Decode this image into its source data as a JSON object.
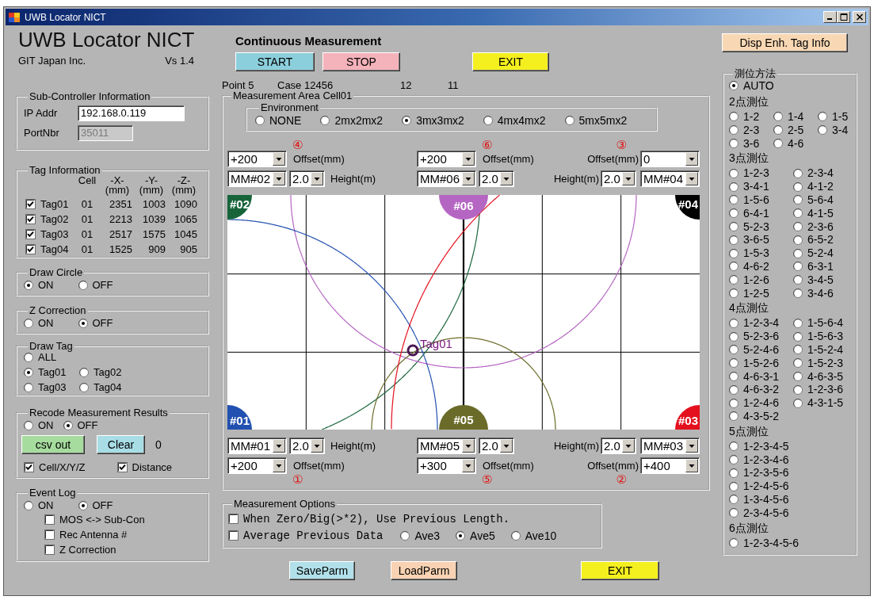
{
  "window": {
    "title": "UWB Locator NICT"
  },
  "header": {
    "title": "UWB Locator NICT",
    "company": "GIT Japan Inc.",
    "version": "Vs 1.4"
  },
  "sub_controller": {
    "title": "Sub-Controller Information",
    "fields": [
      {
        "label": "IP Addr",
        "value": "192.168.0.119",
        "disabled": false
      },
      {
        "label": "PortNbr",
        "value": "35011",
        "disabled": true
      }
    ]
  },
  "tag_information": {
    "title": "Tag Information",
    "columns": [
      {
        "label": "Cell"
      },
      {
        "label": "-X-",
        "unit": "(mm)"
      },
      {
        "label": "-Y-",
        "unit": "(mm)"
      },
      {
        "label": "-Z-",
        "unit": "(mm)"
      }
    ],
    "rows": [
      {
        "checked": true,
        "name": "Tag01",
        "cells": [
          "01",
          "2351",
          "1003",
          "1090"
        ]
      },
      {
        "checked": true,
        "name": "Tag02",
        "cells": [
          "01",
          "2213",
          "1039",
          "1065"
        ]
      },
      {
        "checked": true,
        "name": "Tag03",
        "cells": [
          "01",
          "2517",
          "1575",
          "1045"
        ]
      },
      {
        "checked": true,
        "name": "Tag04",
        "cells": [
          "01",
          "1525",
          "909",
          "905"
        ]
      }
    ]
  },
  "draw_circle": {
    "title": "Draw Circle",
    "options": [
      {
        "label": "ON",
        "selected": true
      },
      {
        "label": "OFF",
        "selected": false
      }
    ]
  },
  "z_correction": {
    "title": "Z Correction",
    "options": [
      {
        "label": "ON",
        "selected": false
      },
      {
        "label": "OFF",
        "selected": true
      }
    ]
  },
  "draw_tag": {
    "title": "Draw Tag",
    "rows": [
      [
        {
          "label": "ALL",
          "selected": false
        }
      ],
      [
        {
          "label": "Tag01",
          "selected": true
        },
        {
          "label": "Tag02",
          "selected": false
        }
      ],
      [
        {
          "label": "Tag03",
          "selected": false
        },
        {
          "label": "Tag04",
          "selected": false
        }
      ]
    ]
  },
  "record_results": {
    "title": "Recode Measurement Results",
    "options": [
      {
        "label": "ON",
        "selected": false
      },
      {
        "label": "OFF",
        "selected": true
      }
    ],
    "buttons": [
      {
        "label": "csv out",
        "color": "#a6dc9e"
      },
      {
        "label": "Clear",
        "color": "#a8dde6"
      }
    ],
    "count": "0",
    "checkboxes": [
      {
        "label": "Cell/X/Y/Z",
        "checked": true
      },
      {
        "label": "Distance",
        "checked": true
      }
    ]
  },
  "event_log": {
    "title": "Event Log",
    "options": [
      {
        "label": "ON",
        "selected": false
      },
      {
        "label": "OFF",
        "selected": true
      }
    ],
    "checkboxes": [
      {
        "label": "MOS <-> Sub-Con",
        "checked": false
      },
      {
        "label": "Rec Antenna #",
        "checked": false
      },
      {
        "label": "Z Correction",
        "checked": false
      }
    ]
  },
  "continuous_measurement": {
    "title": "Continuous Measurement",
    "buttons": [
      {
        "label": "START",
        "color": "#8ccfdc"
      },
      {
        "label": "STOP",
        "color": "#f4b2ba"
      },
      {
        "label": "EXIT",
        "color": "#f4ef1e"
      }
    ]
  },
  "status": [
    "Point 5",
    "Case 12456",
    "12",
    "11"
  ],
  "measurement_area": {
    "title": "Measurement Area Cell01",
    "environment": {
      "title": "Environment",
      "options": [
        {
          "label": "NONE",
          "selected": false
        },
        {
          "label": "2mx2mx2",
          "selected": false
        },
        {
          "label": "3mx3mx2",
          "selected": true
        },
        {
          "label": "4mx4mx2",
          "selected": false
        },
        {
          "label": "5mx5mx2",
          "selected": false
        }
      ]
    },
    "top_panels": [
      {
        "kind": "left",
        "marker": "④",
        "offset": {
          "label": "Offset(mm)",
          "value": "+200"
        },
        "antenna": "MM#02",
        "height": {
          "label": "Height(m)",
          "value": "2.0"
        }
      },
      {
        "kind": "left",
        "marker": "⑥",
        "offset": {
          "label": "Offset(mm)",
          "value": "+200"
        },
        "antenna": "MM#06",
        "height": {
          "value": "2.0"
        }
      },
      {
        "kind": "right",
        "marker": "③",
        "offset": {
          "label": "Offset(mm)",
          "value": "0"
        },
        "antenna": "MM#04",
        "height": {
          "label": "Height(m)",
          "value": "2.0"
        }
      }
    ],
    "map": {
      "top_antennas": [
        {
          "label": "#02",
          "color": "#17643a"
        },
        {
          "label": "#06",
          "color": "#b565c2"
        },
        {
          "label": "#04",
          "color": "#000000"
        }
      ],
      "bottom_antennas": [
        {
          "label": "#01",
          "color": "#2250b0"
        },
        {
          "label": "#05",
          "color": "#6b6b29"
        },
        {
          "label": "#03",
          "color": "#e4101e"
        }
      ],
      "tag": {
        "label": "Tag01"
      }
    },
    "bottom_panels": [
      {
        "kind": "left",
        "marker": "①",
        "offset": {
          "label": "Offset(mm)",
          "value": "+200"
        },
        "antenna": "MM#01",
        "height": {
          "label": "Height(m)",
          "value": "2.0"
        }
      },
      {
        "kind": "left",
        "marker": "⑤",
        "offset": {
          "label": "Offset(mm)",
          "value": "+300"
        },
        "antenna": "MM#05",
        "height": {
          "value": "2.0"
        }
      },
      {
        "kind": "right",
        "marker": "②",
        "offset": {
          "label": "Offset(mm)",
          "value": "+400"
        },
        "antenna": "MM#03",
        "height": {
          "label": "Height(m)",
          "value": "2.0"
        }
      }
    ]
  },
  "measurement_options": {
    "title": "Measurement Options",
    "previous_length": {
      "label": "When Zero/Big(>*2), Use Previous Length.",
      "checked": false
    },
    "average": {
      "label": "Average Previous Data",
      "checked": false,
      "options": [
        {
          "label": "Ave3",
          "selected": false
        },
        {
          "label": "Ave5",
          "selected": true
        },
        {
          "label": "Ave10",
          "selected": false
        }
      ]
    }
  },
  "bottom_buttons": [
    {
      "label": "SaveParm",
      "color": "#b2e0ea"
    },
    {
      "label": "LoadParm",
      "color": "#f8d2b2"
    },
    {
      "label": "EXIT",
      "color": "#f4ef1e"
    }
  ],
  "tag_info_button": {
    "label": "Disp Enh. Tag Info"
  },
  "positioning_method": {
    "title": "測位方法",
    "auto": {
      "label": "AUTO",
      "selected": true
    },
    "sections": [
      {
        "title": "2点測位",
        "options": [
          {
            "label": "1-2",
            "selected": false
          },
          {
            "label": "1-4",
            "selected": false
          },
          {
            "label": "1-5",
            "selected": false
          },
          {
            "label": "2-3",
            "selected": false
          },
          {
            "label": "2-5",
            "selected": false
          },
          {
            "label": "3-4",
            "selected": false
          },
          {
            "label": "3-6",
            "selected": false
          },
          {
            "label": "4-6",
            "selected": false
          }
        ]
      },
      {
        "title": "3点測位",
        "options": [
          {
            "label": "1-2-3",
            "selected": false
          },
          {
            "label": "2-3-4",
            "selected": false
          },
          {
            "label": "3-4-1",
            "selected": false
          },
          {
            "label": "4-1-2",
            "selected": false
          },
          {
            "label": "1-5-6",
            "selected": false
          },
          {
            "label": "5-6-4",
            "selected": false
          },
          {
            "label": "6-4-1",
            "selected": false
          },
          {
            "label": "4-1-5",
            "selected": false
          },
          {
            "label": "5-2-3",
            "selected": false
          },
          {
            "label": "2-3-6",
            "selected": false
          },
          {
            "label": "3-6-5",
            "selected": false
          },
          {
            "label": "6-5-2",
            "selected": false
          },
          {
            "label": "1-5-3",
            "selected": false
          },
          {
            "label": "5-2-4",
            "selected": false
          },
          {
            "label": "4-6-2",
            "selected": false
          },
          {
            "label": "6-3-1",
            "selected": false
          },
          {
            "label": "1-2-6",
            "selected": false
          },
          {
            "label": "3-4-5",
            "selected": false
          },
          {
            "label": "1-2-5",
            "selected": false
          },
          {
            "label": "3-4-6",
            "selected": false
          }
        ]
      },
      {
        "title": "4点測位",
        "options": [
          {
            "label": "1-2-3-4",
            "selected": false
          },
          {
            "label": "1-5-6-4",
            "selected": false
          },
          {
            "label": "5-2-3-6",
            "selected": false
          },
          {
            "label": "1-5-6-3",
            "selected": false
          },
          {
            "label": "5-2-4-6",
            "selected": false
          },
          {
            "label": "1-5-2-4",
            "selected": false
          },
          {
            "label": "1-5-2-6",
            "selected": false
          },
          {
            "label": "1-5-2-3",
            "selected": false
          },
          {
            "label": "4-6-3-1",
            "selected": false
          },
          {
            "label": "4-6-3-5",
            "selected": false
          },
          {
            "label": "4-6-3-2",
            "selected": false
          },
          {
            "label": "1-2-3-6",
            "selected": false
          },
          {
            "label": "1-2-4-6",
            "selected": false
          },
          {
            "label": "4-3-1-5",
            "selected": false
          },
          {
            "label": "4-3-5-2",
            "selected": false
          }
        ]
      },
      {
        "title": "5点測位",
        "options": [
          {
            "label": "1-2-3-4-5",
            "selected": false
          },
          {
            "label": "1-2-3-4-6",
            "selected": false
          },
          {
            "label": "1-2-3-5-6",
            "selected": false
          },
          {
            "label": "1-2-4-5-6",
            "selected": false
          },
          {
            "label": "1-3-4-5-6",
            "selected": false
          },
          {
            "label": "2-3-4-5-6",
            "selected": false
          }
        ]
      },
      {
        "title": "6点測位",
        "options": [
          {
            "label": "1-2-3-4-5-6",
            "selected": false
          }
        ]
      }
    ]
  }
}
